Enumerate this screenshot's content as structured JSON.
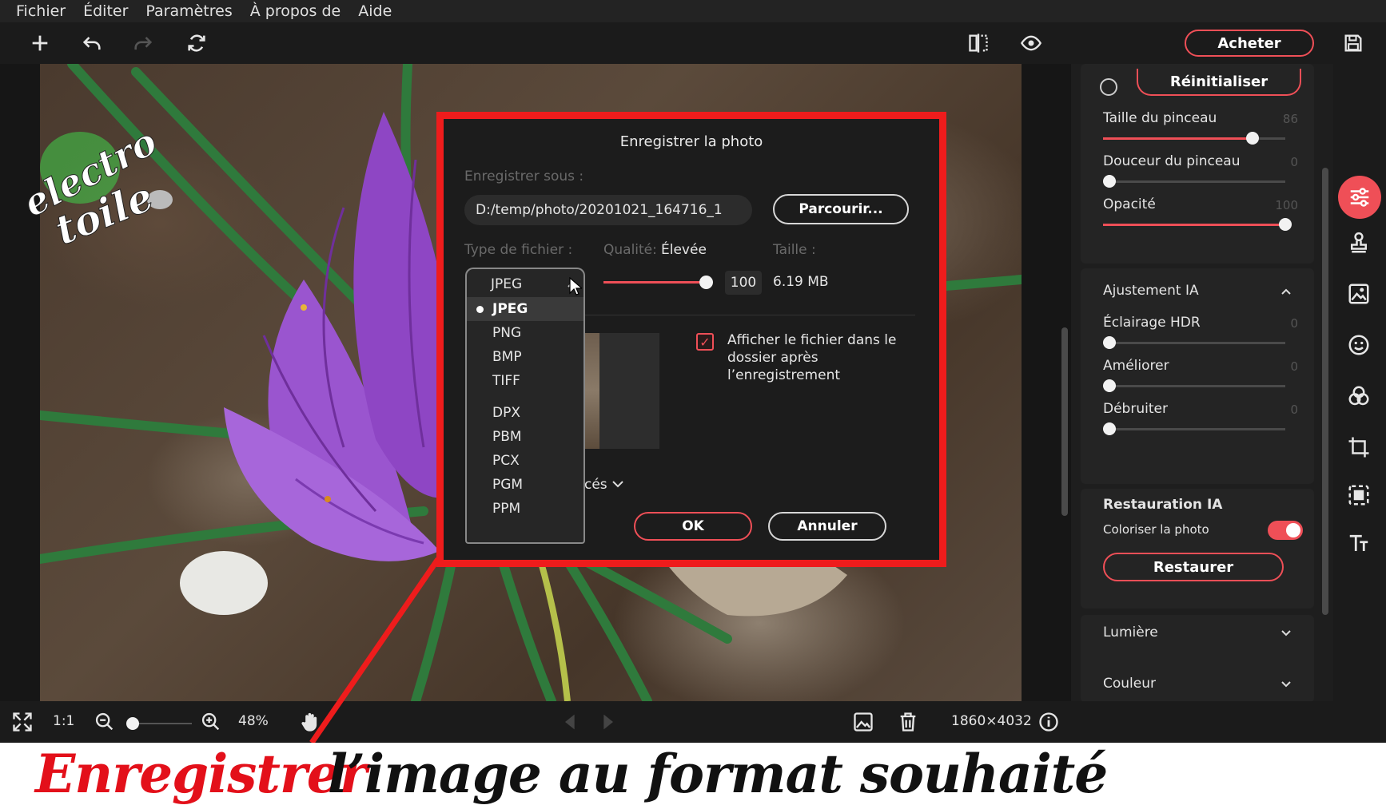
{
  "menu": [
    "Fichier",
    "Éditer",
    "Paramètres",
    "À propos de",
    "Aide"
  ],
  "toolbar": {
    "buy_label": "Acheter"
  },
  "watermark": {
    "line1": "electro",
    "line2": "toile"
  },
  "panel": {
    "reset_label": "Réinitialiser",
    "brush_size": {
      "label": "Taille du pinceau",
      "value": "86",
      "level": 0.82
    },
    "brush_softness": {
      "label": "Douceur du pinceau",
      "value": "0",
      "level": 0
    },
    "opacity": {
      "label": "Opacité",
      "value": "100",
      "level": 1
    },
    "ai_adjust": {
      "title": "Ajustement IA",
      "items": [
        {
          "label": "Éclairage HDR",
          "value": "0"
        },
        {
          "label": "Améliorer",
          "value": "0"
        },
        {
          "label": "Débruiter",
          "value": "0"
        }
      ]
    },
    "ai_restore": {
      "title": "Restauration IA",
      "colorize_label": "Coloriser la photo",
      "colorize_on": true,
      "restore_label": "Restaurer"
    },
    "light_label": "Lumière",
    "color_label": "Couleur"
  },
  "bottom": {
    "ratio": "1:1",
    "zoom": "48%",
    "dimensions": "1860×4032"
  },
  "dialog": {
    "title": "Enregistrer la photo",
    "save_as_label": "Enregistrer sous :",
    "path": "D:/temp/photo/20201021_164716_1",
    "browse_label": "Parcourir...",
    "filetype_label": "Type de fichier :",
    "filetype_value": "JPEG",
    "quality_label": "Qualité:",
    "quality_value": "Élevée",
    "quality_number": "100",
    "size_label": "Taille :",
    "size_value": "6.19 MB",
    "show_file_label": "Afficher le fichier dans le dossier après l’enregistrement",
    "advanced_partial": "cés",
    "ok_label": "OK",
    "cancel_label": "Annuler",
    "formats": [
      "JPEG",
      "PNG",
      "BMP",
      "TIFF",
      "DPX",
      "PBM",
      "PCX",
      "PGM",
      "PPM"
    ],
    "selected_format": "JPEG"
  },
  "caption": {
    "red": "Enregistrer",
    "black": "l’image au format souhaité"
  },
  "colors": {
    "accent": "#ef4f57",
    "highlight": "#ee1c1c"
  }
}
